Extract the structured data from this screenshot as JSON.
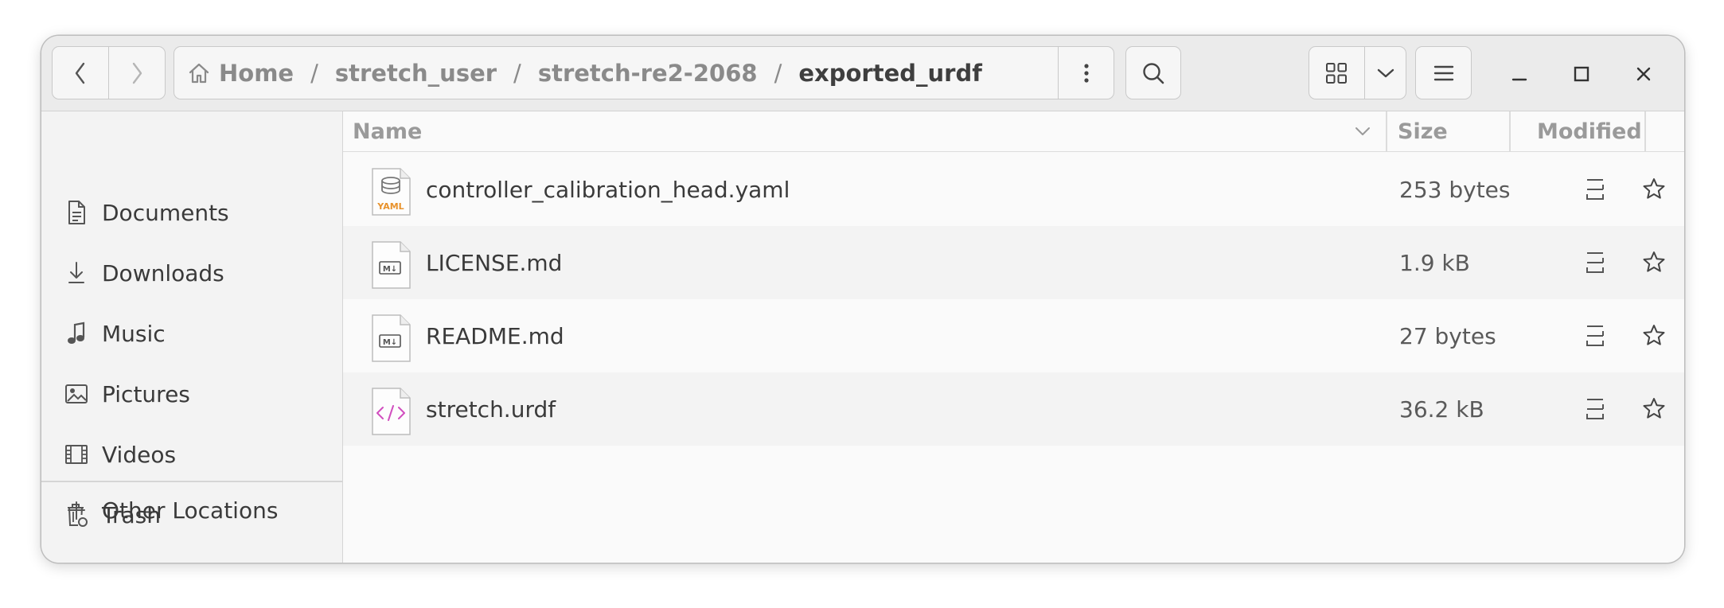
{
  "navigation": {
    "back_icon": "chevron-left-icon",
    "forward_icon": "chevron-right-icon"
  },
  "pathbar": {
    "home_icon": "home-icon",
    "crumbs": [
      "Home",
      "stretch_user",
      "stretch-re2-2068",
      "exported_urdf"
    ],
    "menu_icon": "vertical-dots-icon"
  },
  "toolbar": {
    "search_icon": "search-icon",
    "view_icon": "grid-view-icon",
    "view_dropdown_icon": "chevron-down-icon",
    "menu_icon": "hamburger-menu-icon"
  },
  "window_controls": {
    "minimize": "minimize-icon",
    "maximize": "maximize-icon",
    "close": "close-icon"
  },
  "sidebar": {
    "items": [
      {
        "label": "Documents",
        "icon": "document-icon"
      },
      {
        "label": "Downloads",
        "icon": "download-icon"
      },
      {
        "label": "Music",
        "icon": "music-icon"
      },
      {
        "label": "Pictures",
        "icon": "pictures-icon"
      },
      {
        "label": "Videos",
        "icon": "video-icon"
      },
      {
        "label": "Trash",
        "icon": "trash-icon"
      }
    ],
    "other_locations": {
      "label": "Other Locations",
      "icon": "plus-icon"
    }
  },
  "columns": {
    "name": "Name",
    "size": "Size",
    "modified": "Modified"
  },
  "files": [
    {
      "name": "controller_calibration_head.yaml",
      "size": "253 bytes",
      "type": "yaml"
    },
    {
      "name": "LICENSE.md",
      "size": "1.9 kB",
      "type": "markdown"
    },
    {
      "name": "README.md",
      "size": "27 bytes",
      "type": "markdown"
    },
    {
      "name": "stretch.urdf",
      "size": "36.2 kB",
      "type": "xml"
    }
  ],
  "colors": {
    "accent_orange": "#e8922c",
    "xml_pink": "#d14fbf",
    "text": "#3a3a3a",
    "muted": "#8a8a8a"
  }
}
